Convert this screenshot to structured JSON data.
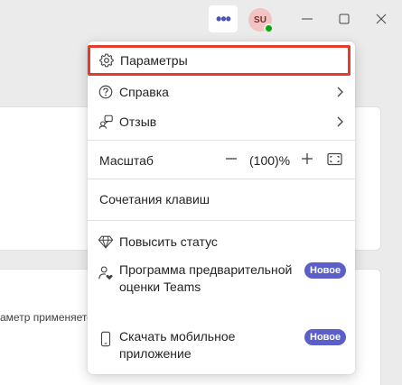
{
  "titlebar": {
    "more_icon": "more-horizontal-icon",
    "avatar_initials": "SU",
    "presence_status": "available",
    "colors": {
      "accent": "#4f52b2",
      "presence": "#13a10e",
      "highlight": "#e33b2e",
      "badge": "#5b5fc7"
    }
  },
  "background": {
    "partial_text": "аметр применяется"
  },
  "menu": {
    "settings_label": "Параметры",
    "help_label": "Справка",
    "feedback_label": "Отзыв",
    "zoom_label": "Масштаб",
    "zoom_value": "(100)%",
    "shortcuts_label": "Сочетания клавиш",
    "upgrade_label": "Повысить статус",
    "preview_label": "Программа предварительной оценки Teams",
    "preview_badge": "Новое",
    "mobile_label": "Скачать мобильное приложение",
    "mobile_badge": "Новое"
  }
}
